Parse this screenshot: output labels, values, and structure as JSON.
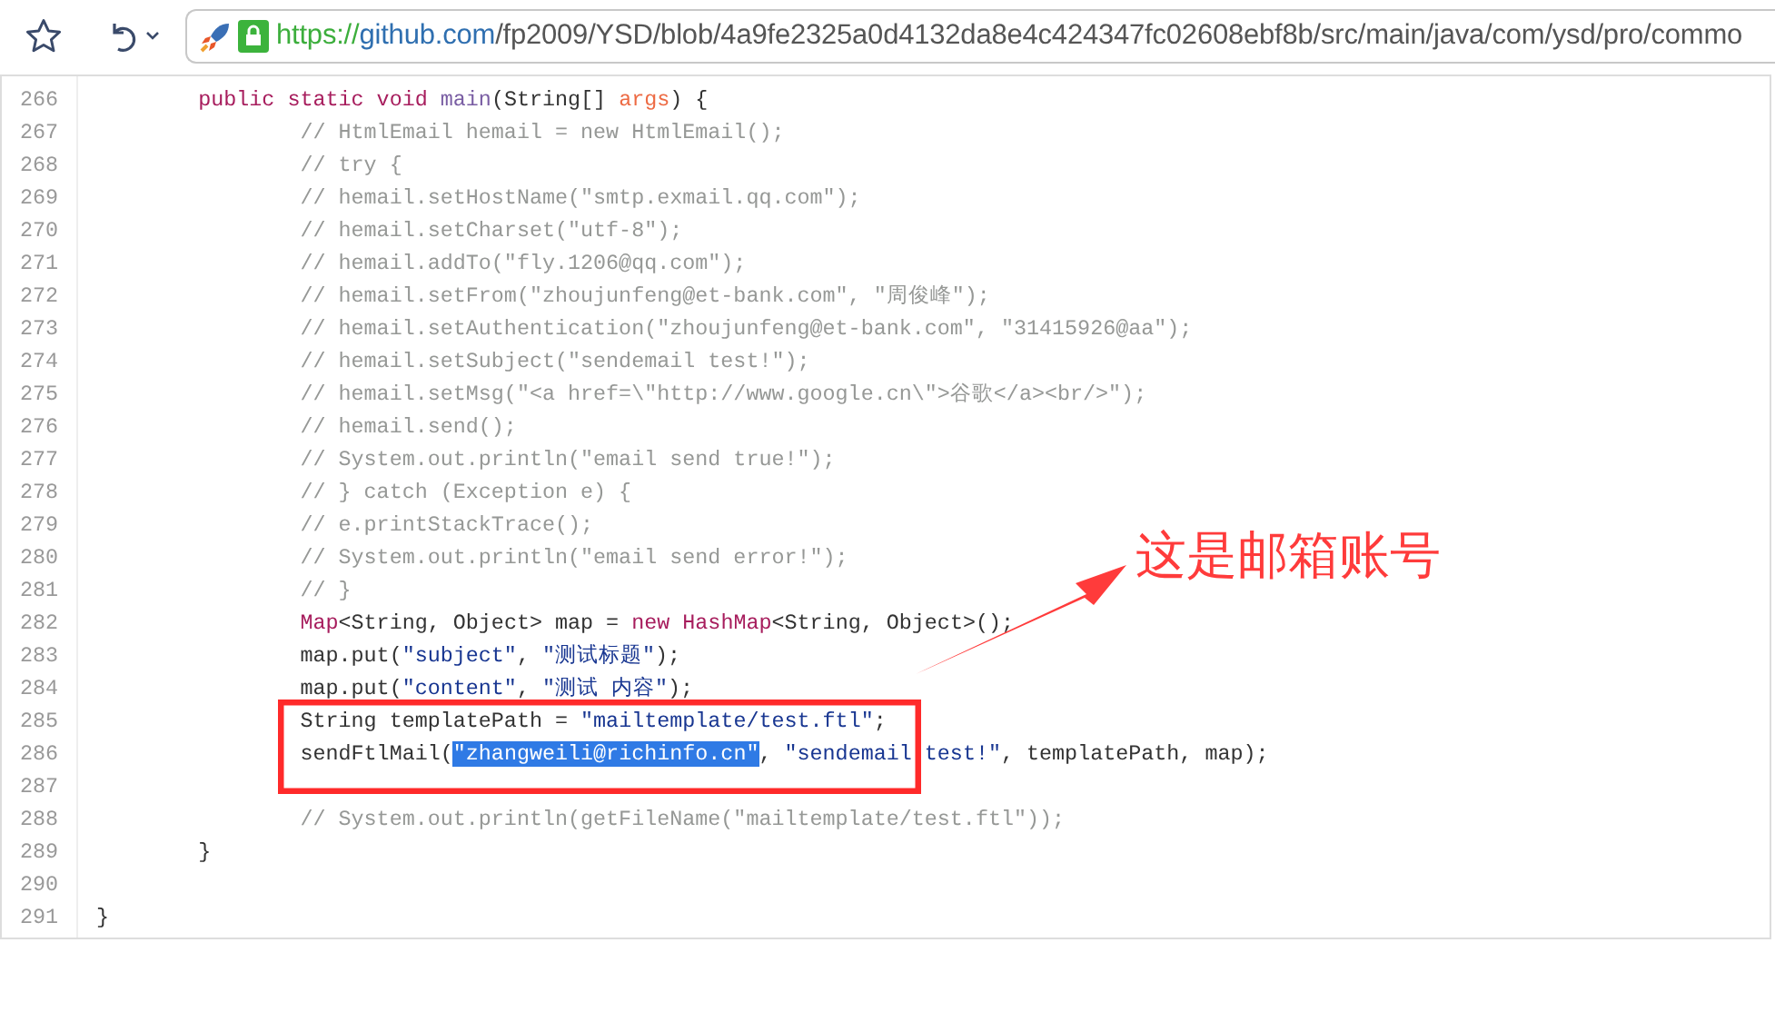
{
  "address_bar": {
    "scheme": "https://",
    "host": "github.com",
    "path": "/fp2009/YSD/blob/4a9fe2325a0d4132da8e4c424347fc02608ebf8b/src/main/java/com/ysd/pro/commo"
  },
  "code_lines": [
    {
      "number": "266",
      "tokens": [
        {
          "kind": "keyword",
          "text": "        public static void "
        },
        {
          "kind": "entity",
          "text": "main"
        },
        {
          "kind": "plain",
          "text": "(String[] "
        },
        {
          "kind": "param",
          "text": "args"
        },
        {
          "kind": "plain",
          "text": ") {"
        }
      ]
    },
    {
      "number": "267",
      "tokens": [
        {
          "kind": "comment",
          "text": "                // HtmlEmail hemail = new HtmlEmail();"
        }
      ]
    },
    {
      "number": "268",
      "tokens": [
        {
          "kind": "comment",
          "text": "                // try {"
        }
      ]
    },
    {
      "number": "269",
      "tokens": [
        {
          "kind": "comment",
          "text": "                // hemail.setHostName(\"smtp.exmail.qq.com\");"
        }
      ]
    },
    {
      "number": "270",
      "tokens": [
        {
          "kind": "comment",
          "text": "                // hemail.setCharset(\"utf-8\");"
        }
      ]
    },
    {
      "number": "271",
      "tokens": [
        {
          "kind": "comment",
          "text": "                // hemail.addTo(\"fly.1206@qq.com\");"
        }
      ]
    },
    {
      "number": "272",
      "tokens": [
        {
          "kind": "comment",
          "text": "                // hemail.setFrom(\"zhoujunfeng@et-bank.com\", \"周俊峰\");"
        }
      ]
    },
    {
      "number": "273",
      "tokens": [
        {
          "kind": "comment",
          "text": "                // hemail.setAuthentication(\"zhoujunfeng@et-bank.com\", \"31415926@aa\");"
        }
      ]
    },
    {
      "number": "274",
      "tokens": [
        {
          "kind": "comment",
          "text": "                // hemail.setSubject(\"sendemail test!\");"
        }
      ]
    },
    {
      "number": "275",
      "tokens": [
        {
          "kind": "comment",
          "text": "                // hemail.setMsg(\"<a href=\\\"http://www.google.cn\\\">谷歌</a><br/>\");"
        }
      ]
    },
    {
      "number": "276",
      "tokens": [
        {
          "kind": "comment",
          "text": "                // hemail.send();"
        }
      ]
    },
    {
      "number": "277",
      "tokens": [
        {
          "kind": "comment",
          "text": "                // System.out.println(\"email send true!\");"
        }
      ]
    },
    {
      "number": "278",
      "tokens": [
        {
          "kind": "comment",
          "text": "                // } catch (Exception e) {"
        }
      ]
    },
    {
      "number": "279",
      "tokens": [
        {
          "kind": "comment",
          "text": "                // e.printStackTrace();"
        }
      ]
    },
    {
      "number": "280",
      "tokens": [
        {
          "kind": "comment",
          "text": "                // System.out.println(\"email send error!\");"
        }
      ]
    },
    {
      "number": "281",
      "tokens": [
        {
          "kind": "comment",
          "text": "                // }"
        }
      ]
    },
    {
      "number": "282",
      "tokens": [
        {
          "kind": "keyword",
          "text": "                Map"
        },
        {
          "kind": "plain",
          "text": "<String, Object> map = "
        },
        {
          "kind": "keyword",
          "text": "new HashMap"
        },
        {
          "kind": "plain",
          "text": "<String, Object>();"
        }
      ]
    },
    {
      "number": "283",
      "tokens": [
        {
          "kind": "plain",
          "text": "                map.put("
        },
        {
          "kind": "string",
          "text": "\"subject\""
        },
        {
          "kind": "plain",
          "text": ", "
        },
        {
          "kind": "string",
          "text": "\"测试标题\""
        },
        {
          "kind": "plain",
          "text": ");"
        }
      ]
    },
    {
      "number": "284",
      "tokens": [
        {
          "kind": "plain",
          "text": "                map.put("
        },
        {
          "kind": "string",
          "text": "\"content\""
        },
        {
          "kind": "plain",
          "text": ", "
        },
        {
          "kind": "string",
          "text": "\"测试 内容\""
        },
        {
          "kind": "plain",
          "text": ");"
        }
      ]
    },
    {
      "number": "285",
      "tokens": [
        {
          "kind": "plain",
          "text": "                String templatePath = "
        },
        {
          "kind": "string",
          "text": "\"mailtemplate/test.ftl\""
        },
        {
          "kind": "plain",
          "text": ";"
        }
      ]
    },
    {
      "number": "286",
      "tokens": [
        {
          "kind": "plain",
          "text": "                sendFtlMail("
        },
        {
          "kind": "selected",
          "text": "\"zhangweili@richinfo.cn\""
        },
        {
          "kind": "plain",
          "text": ", "
        },
        {
          "kind": "string",
          "text": "\"sendemail test!\""
        },
        {
          "kind": "plain",
          "text": ", templatePath, map);"
        }
      ]
    },
    {
      "number": "287"
    },
    {
      "number": "288",
      "tokens": [
        {
          "kind": "comment",
          "text": "                // System.out.println(getFileName(\"mailtemplate/test.ftl\"));"
        }
      ]
    },
    {
      "number": "289",
      "tokens": [
        {
          "kind": "plain",
          "text": "        }"
        }
      ]
    },
    {
      "number": "290"
    },
    {
      "number": "291",
      "tokens": [
        {
          "kind": "plain",
          "text": "}"
        }
      ]
    }
  ],
  "annotation": {
    "text": "这是邮箱账号"
  }
}
